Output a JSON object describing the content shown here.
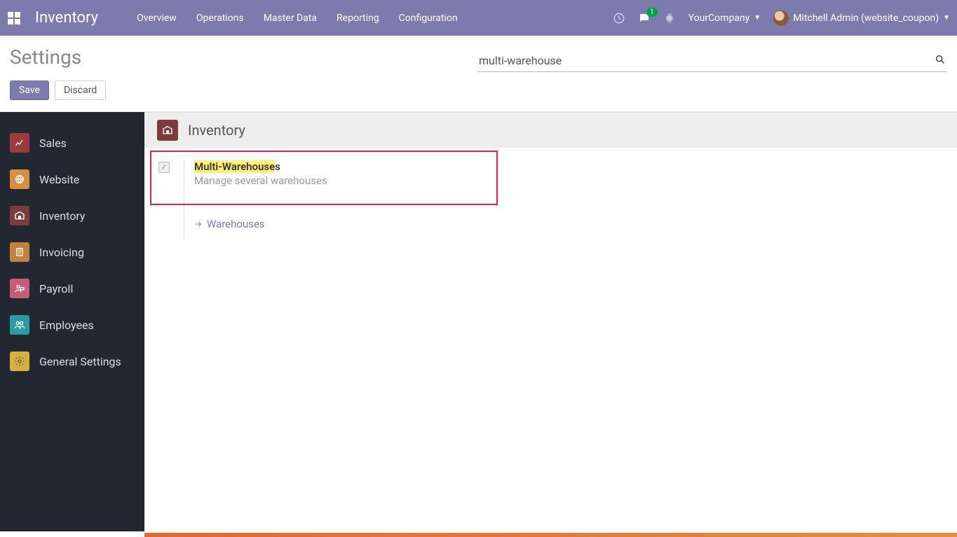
{
  "topbar": {
    "brand": "Inventory",
    "menu": [
      "Overview",
      "Operations",
      "Master Data",
      "Reporting",
      "Configuration"
    ],
    "messages_badge": "1",
    "company": "YourCompany",
    "user": "Mitchell Admin (website_coupon)"
  },
  "header": {
    "title": "Settings",
    "search_value": "multi-warehouse"
  },
  "actions": {
    "save": "Save",
    "discard": "Discard"
  },
  "sidebar": {
    "items": [
      {
        "label": "Sales"
      },
      {
        "label": "Website"
      },
      {
        "label": "Inventory"
      },
      {
        "label": "Invoicing"
      },
      {
        "label": "Payroll"
      },
      {
        "label": "Employees"
      },
      {
        "label": "General Settings"
      }
    ]
  },
  "section": {
    "title": "Inventory"
  },
  "setting": {
    "title_hl": "Multi-Warehouse",
    "title_rest": "s",
    "desc": "Manage several warehouses",
    "link": "Warehouses"
  }
}
